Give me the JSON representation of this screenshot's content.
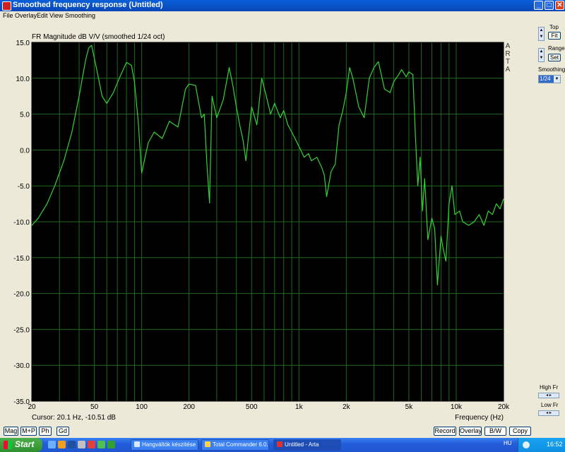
{
  "window": {
    "title": "Smoothed frequency response (Untitled)",
    "min_glyph": "_",
    "max_glyph": "□",
    "close_glyph": "✕"
  },
  "menu": [
    "File",
    "Overlay",
    "Edit",
    "View",
    "Smoothing"
  ],
  "right_panel": {
    "top_label": "Top",
    "top_button": "Fit",
    "range_label": "Range",
    "range_button": "Set",
    "smoothing_label": "Smoothing",
    "smoothing_value": "1/24",
    "high_fr_label": "High Fr",
    "low_fr_label": "Low Fr"
  },
  "bottom_left_buttons": [
    "Mag",
    "M+P",
    "Ph",
    "Gd"
  ],
  "bottom_right_buttons": [
    "Record",
    "Overlay",
    "B/W",
    "Copy"
  ],
  "taskbar": {
    "start_label": "Start",
    "tasks": [
      {
        "label": "Hangváltók készítése ...",
        "active": false,
        "icon_color": "#d8e8ff"
      },
      {
        "label": "Total Commander 6.0...",
        "active": false,
        "icon_color": "#ffd24a"
      },
      {
        "label": "Untitled - Arta",
        "active": true,
        "icon_color": "#e03030"
      }
    ],
    "language": "HU",
    "clock": "16:52"
  },
  "chart_data": {
    "type": "line",
    "title": "FR Magnitude dB V/V (smoothed 1/24 oct)",
    "xlabel": "Frequency (Hz)",
    "ylabel": "",
    "xscale": "log",
    "xlim": [
      20,
      20000
    ],
    "ylim": [
      -35,
      15
    ],
    "x_ticks": [
      20,
      50,
      100,
      200,
      500,
      1000,
      2000,
      5000,
      10000,
      20000
    ],
    "x_tick_labels": [
      "20",
      "50",
      "100",
      "200",
      "500",
      "1k",
      "2k",
      "5k",
      "10k",
      "20k"
    ],
    "y_ticks": [
      15,
      10,
      5,
      0,
      -5,
      -10,
      -15,
      -20,
      -25,
      -30,
      -35
    ],
    "y_tick_labels": [
      "15.0",
      "10.0",
      "5.0",
      "0.0",
      "-5.0",
      "-10.0",
      "-15.0",
      "-20.0",
      "-25.0",
      "-30.0",
      "-35.0"
    ],
    "grid": true,
    "watermark": "ARTA",
    "cursor_readout": "Cursor: 20.1 Hz, -10.51 dB",
    "colors": {
      "background": "#000000",
      "grid": "#1e6a1e",
      "line": "#36d236",
      "text": "#000000"
    },
    "series": [
      {
        "x": [
          20,
          22,
          25,
          28,
          32,
          36,
          40,
          44,
          46,
          48,
          52,
          56,
          60,
          66,
          72,
          80,
          86,
          90,
          95,
          100,
          105,
          110,
          120,
          135,
          150,
          170,
          190,
          200,
          220,
          240,
          250,
          260,
          270,
          280,
          300,
          330,
          360,
          380,
          400,
          420,
          440,
          460,
          500,
          540,
          580,
          620,
          660,
          700,
          760,
          800,
          850,
          900,
          950,
          1000,
          1080,
          1150,
          1200,
          1300,
          1400,
          1450,
          1500,
          1600,
          1700,
          1800,
          1900,
          2000,
          2100,
          2200,
          2400,
          2600,
          2800,
          3000,
          3200,
          3500,
          3800,
          4000,
          4300,
          4500,
          4800,
          5000,
          5300,
          5500,
          5700,
          5900,
          6100,
          6300,
          6600,
          7000,
          7300,
          7600,
          8000,
          8300,
          8600,
          9000,
          9400,
          9800,
          10500,
          11000,
          12000,
          13000,
          14000,
          15000,
          16000,
          17000,
          18000,
          19000,
          20000
        ],
        "y": [
          -10.5,
          -9.5,
          -7.5,
          -5,
          -1.5,
          2.5,
          7.5,
          12.5,
          14.2,
          14.6,
          11,
          7.5,
          6.5,
          8,
          10,
          12.2,
          11.8,
          9.5,
          4,
          -3.2,
          -1,
          1,
          2.5,
          1.6,
          4,
          3.2,
          8.5,
          9.2,
          9,
          4.5,
          5,
          -2,
          -7.4,
          7.5,
          4.5,
          7,
          11.5,
          9,
          6,
          3.5,
          1.5,
          -1.5,
          6,
          3.5,
          10,
          7.5,
          5,
          6.5,
          4.5,
          5.5,
          3.5,
          2.5,
          1.5,
          0.5,
          -1,
          -0.5,
          -1.5,
          -1,
          -2.5,
          -3.5,
          -6.5,
          -3,
          -2,
          3.5,
          5.5,
          8,
          11.5,
          10,
          6,
          4.5,
          10,
          11.5,
          12.3,
          8.5,
          8,
          9.5,
          10.5,
          11.2,
          10.2,
          10.9,
          10.5,
          2,
          -5,
          -1,
          -8.5,
          -4,
          -12.5,
          -9.5,
          -11,
          -18.8,
          -12,
          -14,
          -15.5,
          -7.5,
          -5,
          -9,
          -8.5,
          -10,
          -10.5,
          -10,
          -9,
          -10.5,
          -8.5,
          -9,
          -7.5,
          -8.2,
          -6.8
        ]
      }
    ]
  }
}
